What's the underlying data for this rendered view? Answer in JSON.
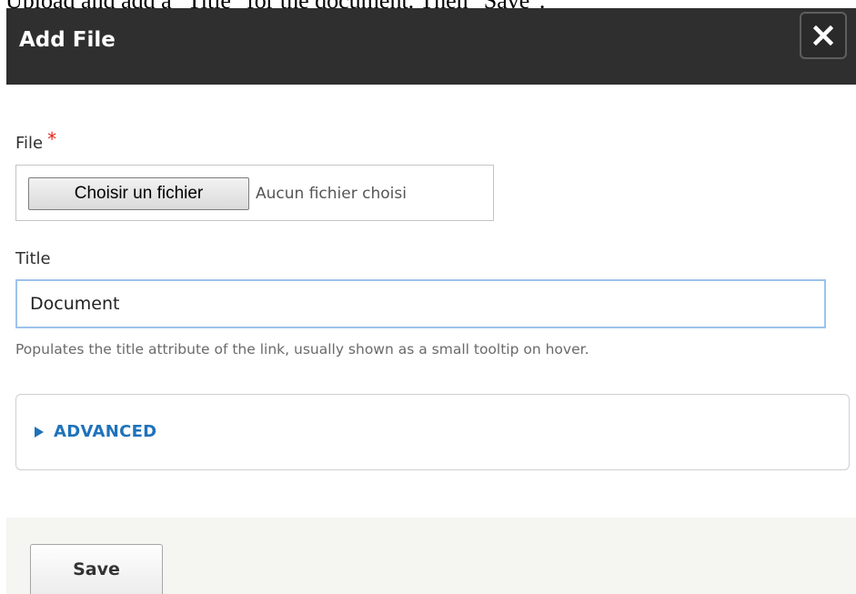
{
  "instruction": "Upload and add a \"Title\" for the document. Then \"Save\".",
  "dialog": {
    "title": "Add File",
    "close_label": "×"
  },
  "file_field": {
    "label": "File",
    "required_marker": "*",
    "button_label": "Choisir un fichier",
    "status": "Aucun fichier choisi"
  },
  "title_field": {
    "label": "Title",
    "value": "Document",
    "help": "Populates the title attribute of the link, usually shown as a small tooltip on hover."
  },
  "advanced": {
    "label": "ADVANCED",
    "icon": "triangle-right-icon"
  },
  "footer": {
    "save_label": "Save"
  },
  "colors": {
    "header_bg": "#2f2f2f",
    "required": "#e2231a",
    "link": "#1f72ba",
    "input_focus_border": "#9dc3ea",
    "footer_bg": "#f5f5f2"
  }
}
